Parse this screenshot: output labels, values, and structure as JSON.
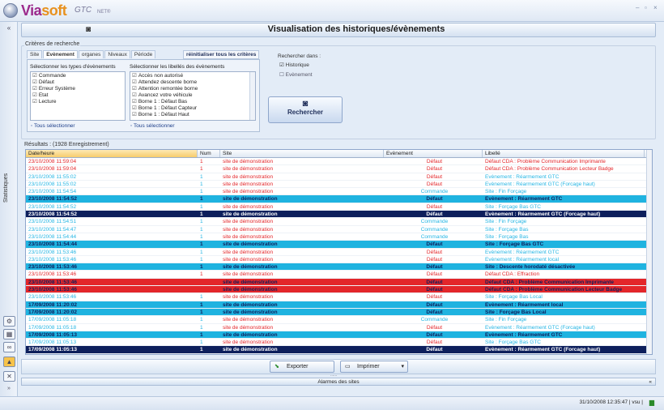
{
  "app": {
    "logo_main": "Via",
    "logo_accent": "soft",
    "logo_suffix": "GTC",
    "logo_net": "NET®"
  },
  "window_controls": [
    "–",
    "▫",
    "×"
  ],
  "sidebar": {
    "tab_label": "«",
    "vertical_label": "Statistiques",
    "icons": [
      "gear-icon",
      "chart-icon",
      "link-icon",
      "alarm-icon",
      "tools-icon"
    ]
  },
  "header": {
    "title": "Visualisation des historiques/évènements",
    "icon": "binoculars-icon"
  },
  "criteria": {
    "legend": "Critères de recherche",
    "tabs": [
      "Site",
      "Evènement",
      "organes",
      "Niveaux",
      "Période"
    ],
    "active_tab": "Evènement",
    "reset_label": "réinitialiser tous les critères",
    "types_label": "Sélectionner les types d'évènements",
    "types": [
      "Commande",
      "Défaut",
      "Erreur Système",
      "Etat",
      "Lecture"
    ],
    "libelles_label": "Sélectionner les libellés des évènements",
    "libelles": [
      "Accès non autorisé",
      "Attendez descente borne",
      "Attention remontée borne",
      "Avancez votre véhicule",
      "Borne 1 : Défaut Bas",
      "Borne 1 : Défaut Capteur",
      "Borne 1 : Défaut Haut"
    ],
    "select_all_types": "Tous sélectionner",
    "select_all_libelles": "Tous sélectionner",
    "search_in_label": "Rechercher dans :",
    "search_in": [
      "Historique",
      "Evènement"
    ],
    "search_button": "Rechercher"
  },
  "results": {
    "legend": "Résultats : (1928 Enregistrement)",
    "columns": [
      "Date/heure",
      "Num",
      "Site",
      "Evènement",
      "Libellé"
    ],
    "rows": [
      {
        "d": "23/10/2008 11:59:04",
        "n": "1",
        "s": "site de démonstration",
        "e": "Défaut",
        "l": "Défaut CDA : Problème Communication Imprimante",
        "st": "red"
      },
      {
        "d": "23/10/2008 11:59:04",
        "n": "1",
        "s": "site de démonstration",
        "e": "Défaut",
        "l": "Défaut CDA : Problème Communication Lecteur Badge",
        "st": "red"
      },
      {
        "d": "23/10/2008 11:55:02",
        "n": "1",
        "s": "site de démonstration",
        "e": "Défaut",
        "l": "Evènement : Réarmement GTC",
        "st": "cyan"
      },
      {
        "d": "23/10/2008 11:55:02",
        "n": "1",
        "s": "site de démonstration",
        "e": "Défaut",
        "l": "Evènement : Réarmement GTC (Forcage haut)",
        "st": "cyan"
      },
      {
        "d": "23/10/2008 11:54:54",
        "n": "1",
        "s": "site de démonstration",
        "e": "Commande",
        "l": "Site : Fin Forçage",
        "st": "cyan"
      },
      {
        "d": "23/10/2008 11:54:52",
        "n": "1",
        "s": "site de démonstration",
        "e": "Défaut",
        "l": "Evènement : Réarmement GTC",
        "st": "hl-cyan"
      },
      {
        "d": "23/10/2008 11:54:52",
        "n": "1",
        "s": "site de démonstration",
        "e": "Défaut",
        "l": "Site : Forçage Bas GTC",
        "st": "cyan"
      },
      {
        "d": "23/10/2008 11:54:52",
        "n": "1",
        "s": "site de démonstration",
        "e": "Défaut",
        "l": "Evènement : Réarmement GTC (Forcage haut)",
        "st": "hl-navy"
      },
      {
        "d": "23/10/2008 11:54:51",
        "n": "1",
        "s": "site de démonstration",
        "e": "Commande",
        "l": "Site : Fin Forçage",
        "st": "cyan"
      },
      {
        "d": "23/10/2008 11:54:47",
        "n": "1",
        "s": "site de démonstration",
        "e": "Commande",
        "l": "Site : Forçage Bas",
        "st": "cyan"
      },
      {
        "d": "23/10/2008 11:54:44",
        "n": "1",
        "s": "site de démonstration",
        "e": "Commande",
        "l": "Site : Forçage Bas",
        "st": "cyan"
      },
      {
        "d": "23/10/2008 11:54:44",
        "n": "1",
        "s": "site de démonstration",
        "e": "Défaut",
        "l": "Site : Forçage Bas GTC",
        "st": "hl-cyan"
      },
      {
        "d": "23/10/2008 11:53:46",
        "n": "1",
        "s": "site de démonstration",
        "e": "Défaut",
        "l": "Evènement : Réarmement GTC",
        "st": "cyan"
      },
      {
        "d": "23/10/2008 11:53:46",
        "n": "1",
        "s": "site de démonstration",
        "e": "Défaut",
        "l": "Evènement : Réarmement local",
        "st": "cyan"
      },
      {
        "d": "23/10/2008 11:53:46",
        "n": "1",
        "s": "site de démonstration",
        "e": "Défaut",
        "l": "Site : Descente horodaté désactivée",
        "st": "hl-cyan"
      },
      {
        "d": "23/10/2008 11:53:46",
        "n": "1",
        "s": "site de démonstration",
        "e": "Défaut",
        "l": "Défaut CDA : Effraction",
        "st": "red"
      },
      {
        "d": "23/10/2008 11:53:46",
        "n": "1",
        "s": "site de démonstration",
        "e": "Défaut",
        "l": "Défaut CDA : Problème Communication Imprimante",
        "st": "hl-red"
      },
      {
        "d": "23/10/2008 11:53:46",
        "n": "1",
        "s": "site de démonstration",
        "e": "Défaut",
        "l": "Défaut CDA : Problème Communication Lecteur Badge",
        "st": "hl-red"
      },
      {
        "d": "23/10/2008 11:53:46",
        "n": "1",
        "s": "site de démonstration",
        "e": "Défaut",
        "l": "Site : Forçage Bas Local",
        "st": "cyan"
      },
      {
        "d": "17/09/2008 11:20:02",
        "n": "1",
        "s": "site de démonstration",
        "e": "Défaut",
        "l": "Evènement : Réarmement local",
        "st": "hl-cyan"
      },
      {
        "d": "17/09/2008 11:20:02",
        "n": "1",
        "s": "site de démonstration",
        "e": "Défaut",
        "l": "Site : Forçage Bas Local",
        "st": "hl-cyan"
      },
      {
        "d": "17/09/2008 11:05:18",
        "n": "1",
        "s": "site de démonstration",
        "e": "Commande",
        "l": "Site : Fin Forçage",
        "st": "cyan"
      },
      {
        "d": "17/09/2008 11:05:18",
        "n": "1",
        "s": "site de démonstration",
        "e": "Défaut",
        "l": "Evènement : Réarmement GTC (Forcage haut)",
        "st": "cyan"
      },
      {
        "d": "17/09/2008 11:05:13",
        "n": "1",
        "s": "site de démonstration",
        "e": "Défaut",
        "l": "Evènement : Réarmement GTC",
        "st": "hl-cyan"
      },
      {
        "d": "17/09/2008 11:05:13",
        "n": "1",
        "s": "site de démonstration",
        "e": "Défaut",
        "l": "Site : Forçage Bas GTC",
        "st": "cyan"
      },
      {
        "d": "17/09/2008 11:05:13",
        "n": "1",
        "s": "site de démonstration",
        "e": "Défaut",
        "l": "Evènement : Réarmement GTC (Forcage haut)",
        "st": "hl-navy"
      }
    ]
  },
  "actions": {
    "export": "Exporter",
    "print": "Imprimer",
    "grip": "......"
  },
  "alarms_bar": "Alarmes des sites",
  "status": "31/10/2008 12:35:47 | vsu |",
  "colors": {
    "cyan": "#27b6e4",
    "red": "#e3262a",
    "hl_cyan": "#1fb3e0",
    "hl_red": "#e3262a",
    "navy": "#0d1f5c",
    "brand": "#9c2a8c"
  }
}
